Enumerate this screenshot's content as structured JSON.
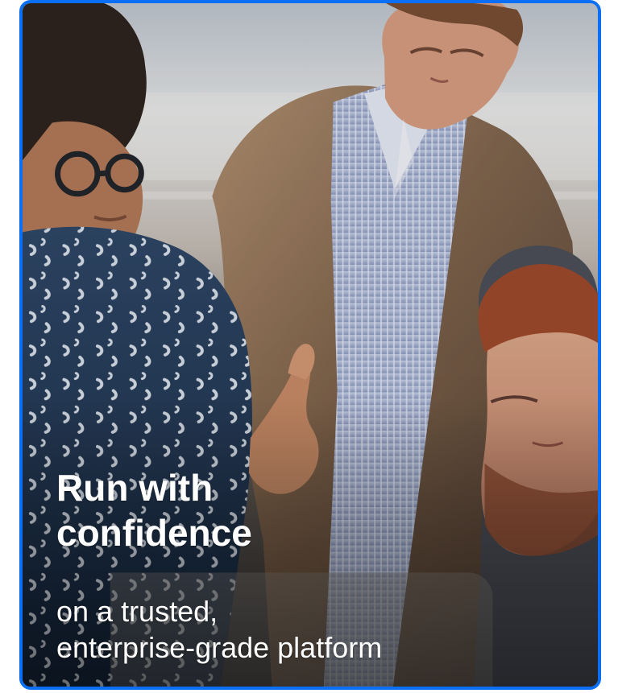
{
  "hero": {
    "headline": [
      "Run with",
      "confidence"
    ],
    "subhead": [
      "on a trusted,",
      "enterprise-grade platform"
    ],
    "image": "three business professionals reviewing work together"
  },
  "colors": {
    "border": "#0b6ff5",
    "text": "#ffffff"
  }
}
